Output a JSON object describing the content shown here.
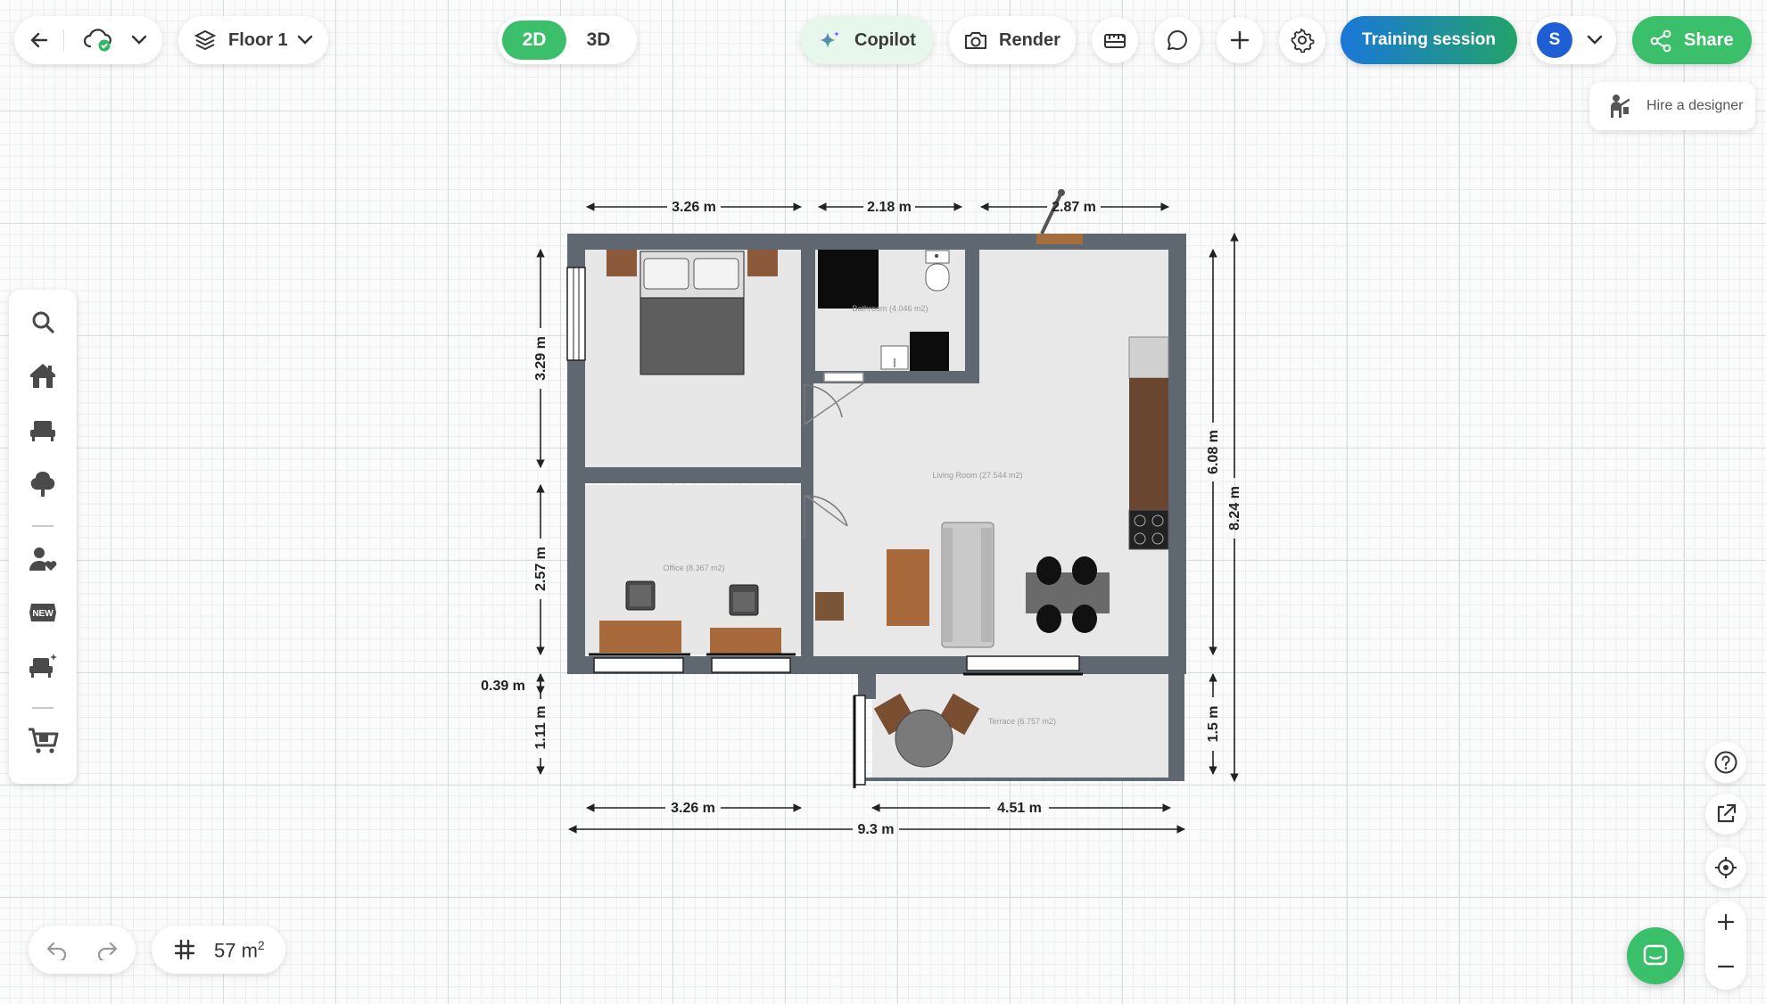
{
  "toolbar": {
    "floor_label": "Floor 1",
    "view_2d": "2D",
    "view_3d": "3D",
    "copilot_label": "Copilot",
    "render_label": "Render",
    "training_label": "Training session",
    "avatar_initial": "S",
    "share_label": "Share",
    "hire_designer_label": "Hire a designer"
  },
  "colors": {
    "accent_green": "#3cbf6a",
    "training_blue": "#1e80d8",
    "avatar_blue": "#1f5fd6",
    "copilot_bg": "#e8f7ec",
    "wall": "#5f6871",
    "floor": "#e9e9e9"
  },
  "plan": {
    "dimensions": {
      "top_1": "3.26 m",
      "top_2": "2.18 m",
      "top_3": "2.87 m",
      "left_1": "3.29 m",
      "left_2": "2.57 m",
      "left_3": "0.39 m",
      "left_4": "1.11 m",
      "right_inner_1": "6.08 m",
      "right_inner_2": "1.5 m",
      "right_outer": "8.24 m",
      "bottom_1": "3.26 m",
      "bottom_2": "4.51 m",
      "bottom_total": "9.3 m"
    },
    "rooms": {
      "bathroom": "Bathroom (4.046 m2)",
      "living": "Living Room (27.544 m2)",
      "office": "Office (8.367 m2)",
      "terrace": "Terrace (6.757 m2)"
    }
  },
  "status": {
    "area_value": "57 m",
    "area_unit_sup": "2"
  }
}
